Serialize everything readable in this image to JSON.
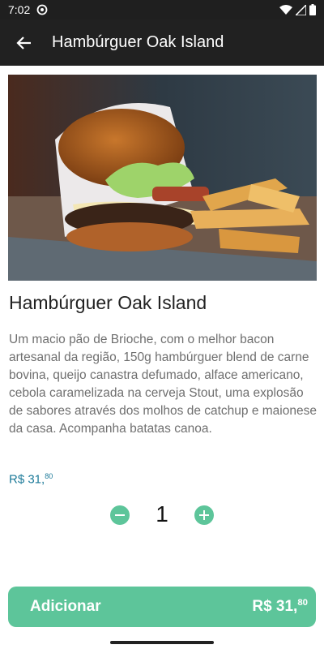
{
  "status_bar": {
    "time": "7:02",
    "app_icon": "notification-icon",
    "icons": [
      "wifi-icon",
      "signal-icon",
      "battery-icon"
    ]
  },
  "app_bar": {
    "back_icon": "arrow-left-icon",
    "title": "Hambúrguer Oak Island"
  },
  "product": {
    "image": "burger-with-fries-photo",
    "title": "Hambúrguer Oak Island",
    "description": "Um macio pão de Brioche, com o melhor bacon artesanal da região, 150g hambúrguer blend de carne bovina, queijo canastra defumado, alface americano, cebola caramelizada na cerveja Stout, uma explosão de sabores através dos molhos de catchup e maionese da casa. Acompanha batatas canoa.",
    "price_main": "R$ 31,",
    "price_cents": "80"
  },
  "quantity": {
    "value": "1",
    "minus_icon": "minus-circle-icon",
    "plus_icon": "plus-circle-icon"
  },
  "add_button": {
    "label": "Adicionar",
    "price_main": "R$ 31,",
    "price_cents": "80"
  },
  "colors": {
    "accent": "#5dc59a",
    "price": "#1c7a99",
    "app_bar": "#212121"
  }
}
